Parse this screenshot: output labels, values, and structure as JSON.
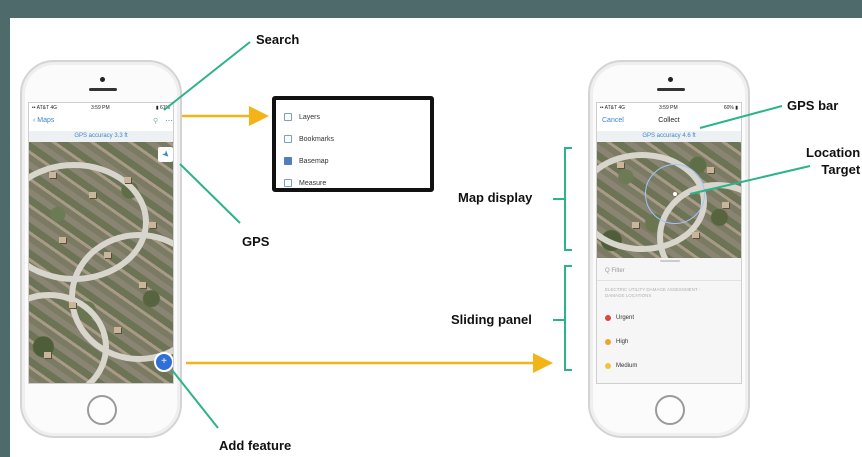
{
  "callouts": {
    "search": "Search",
    "gps": "GPS",
    "add_feature": "Add feature",
    "gps_bar": "GPS bar",
    "location_target": "Location\nTarget",
    "map_display": "Map display",
    "sliding_panel": "Sliding panel"
  },
  "left_phone": {
    "status": {
      "carrier": "•• AT&T 4G",
      "time": "3:59 PM",
      "battery": "▮ 61%"
    },
    "nav": {
      "back_label": "Maps",
      "search_icon": "search-icon",
      "more_icon": "more-icon"
    },
    "gps_accuracy": "GPS accuracy 3.3 ft",
    "gps_button_icon": "navigation-arrow-icon",
    "add_button_label": "+"
  },
  "menu": {
    "items": [
      {
        "label": "Layers",
        "icon": "layers-icon"
      },
      {
        "label": "Bookmarks",
        "icon": "bookmarks-icon"
      },
      {
        "label": "Basemap",
        "icon": "basemap-icon"
      },
      {
        "label": "Measure",
        "icon": "measure-icon"
      }
    ]
  },
  "right_phone": {
    "status": {
      "carrier": "•• AT&T 4G",
      "time": "3:59 PM",
      "battery": "60% ▮"
    },
    "nav": {
      "cancel_label": "Cancel",
      "title": "Collect"
    },
    "gps_accuracy": "GPS accuracy 4.6 ft",
    "panel": {
      "filter_placeholder": "Q Filter",
      "heading": "ELECTRIC UTILITY DAMAGE ASSESSMENT - DAMAGE LOCATIONS",
      "items": [
        {
          "label": "Urgent",
          "color": "#e0463a"
        },
        {
          "label": "High",
          "color": "#f0a233"
        },
        {
          "label": "Medium",
          "color": "#f3c23c"
        }
      ]
    }
  },
  "colors": {
    "callout_line": "#2bb38a",
    "arrow": "#f2b418",
    "frame": "#4e6a6a",
    "accent_blue": "#3a86c8"
  }
}
